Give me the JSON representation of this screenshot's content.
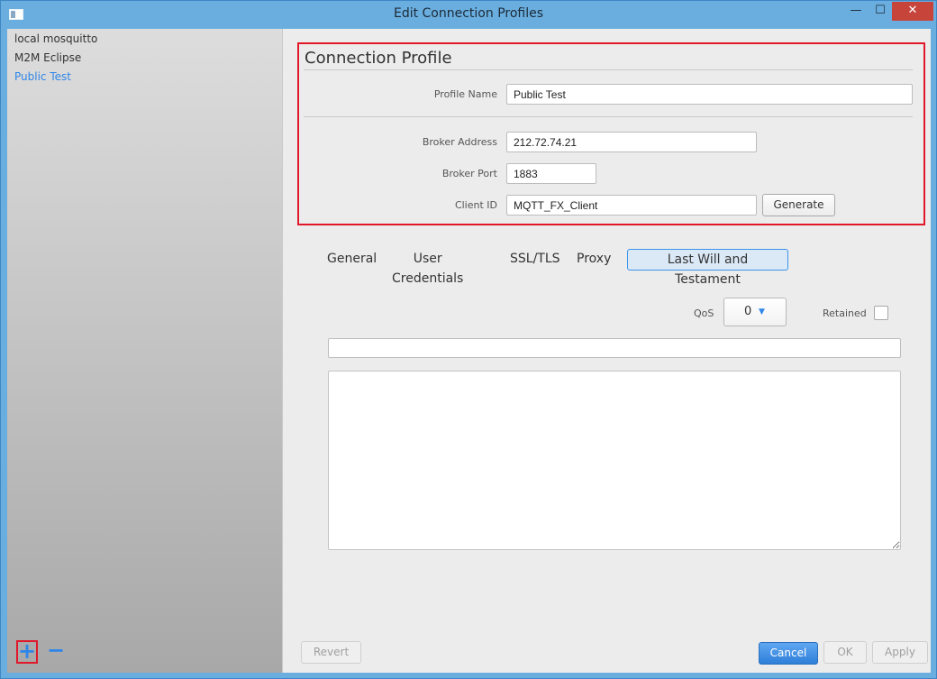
{
  "window": {
    "title": "Edit Connection Profiles",
    "minimize_glyph": "—",
    "maximize_glyph": "☐",
    "close_glyph": "✕"
  },
  "sidebar": {
    "profiles": [
      {
        "label": "local mosquitto"
      },
      {
        "label": "M2M Eclipse"
      },
      {
        "label": "Public Test"
      }
    ],
    "selected_profile": "Public Test",
    "add_glyph": "+",
    "remove_glyph": "−"
  },
  "connection_profile": {
    "heading": "Connection Profile",
    "profile_name_label": "Profile Name",
    "profile_name_value": "Public Test",
    "broker_address_label": "Broker Address",
    "broker_address_value": "212.72.74.21",
    "broker_port_label": "Broker Port",
    "broker_port_value": "1883",
    "client_id_label": "Client ID",
    "client_id_value": "MQTT_FX_Client",
    "generate_label": "Generate"
  },
  "tabs": [
    {
      "label": "General"
    },
    {
      "label": "User Credentials"
    },
    {
      "label": "SSL/TLS"
    },
    {
      "label": "Proxy"
    },
    {
      "label": "Last Will and Testament"
    }
  ],
  "selected_tab": "Last Will and Testament",
  "lwt": {
    "qos_label": "QoS",
    "qos_value": "0",
    "retained_label": "Retained",
    "retained_checked": false,
    "topic_value": "",
    "message_value": ""
  },
  "footer": {
    "revert_label": "Revert",
    "cancel_label": "Cancel",
    "ok_label": "OK",
    "apply_label": "Apply"
  },
  "colors": {
    "accent": "#2f86e8",
    "highlight_border": "#e0182a",
    "titlebar": "#6aaee0",
    "close_button": "#c7443b"
  },
  "icons": {
    "app": "window-app-icon",
    "qos_dropdown": "chevron-down-icon",
    "add": "plus-icon",
    "remove": "minus-icon"
  }
}
